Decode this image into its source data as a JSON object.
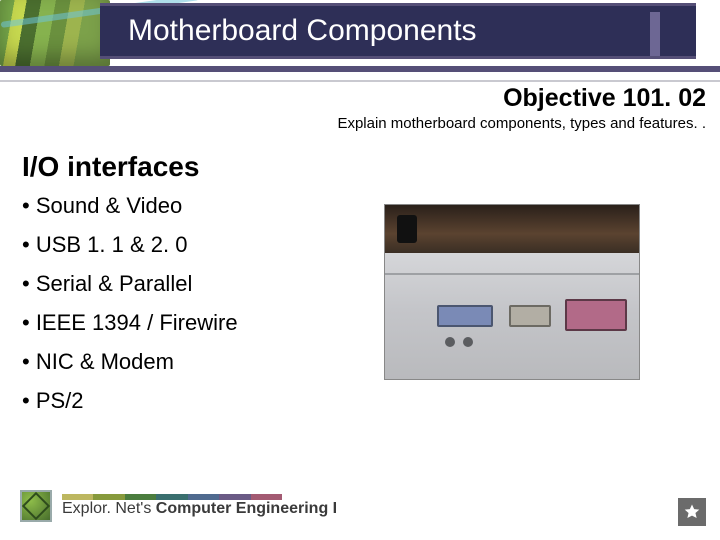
{
  "header": {
    "title": "Motherboard Components"
  },
  "objective": {
    "label": "Objective 101. 02",
    "description": "Explain motherboard components, types and features. ."
  },
  "section_title": "I/O interfaces",
  "bullets": [
    "• Sound & Video",
    "• USB 1. 1 & 2. 0",
    "• Serial & Parallel",
    "• IEEE 1394 / Firewire",
    "• NIC & Modem",
    "• PS/2"
  ],
  "footer": {
    "brand_a": "Explor. Net's ",
    "brand_b": "Computer Engineering I"
  }
}
